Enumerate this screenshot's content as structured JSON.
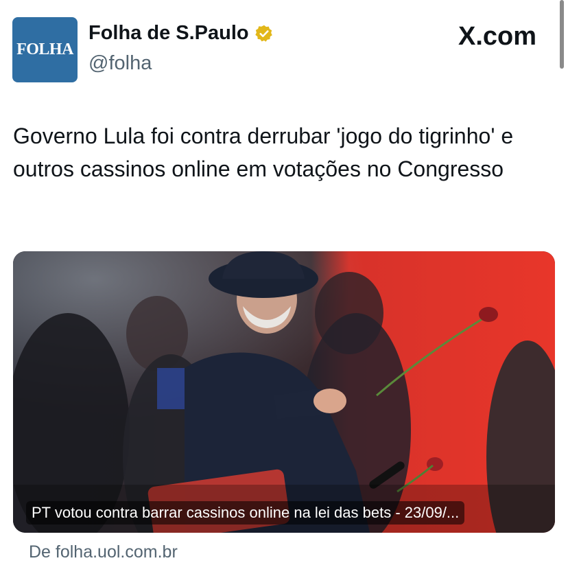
{
  "tweet": {
    "author_name": "Folha de S.Paulo",
    "handle": "@folha",
    "avatar_text": "FOLHA",
    "brand_logo": "X.com",
    "text": "Governo Lula foi contra derrubar 'jogo do tigrinho' e outros cassinos online em votações no Congresso",
    "card": {
      "caption": "PT votou contra barrar cassinos online na lei das bets - 23/09/...",
      "source": "De folha.uol.com.br"
    }
  },
  "colors": {
    "avatar_bg": "#2f6ea3",
    "verified_badge": "#e2b719",
    "secondary_text": "#536471",
    "photo_red_backdrop": "#e8362a"
  },
  "icons": [
    "verified-badge-icon",
    "x-logo-icon"
  ]
}
